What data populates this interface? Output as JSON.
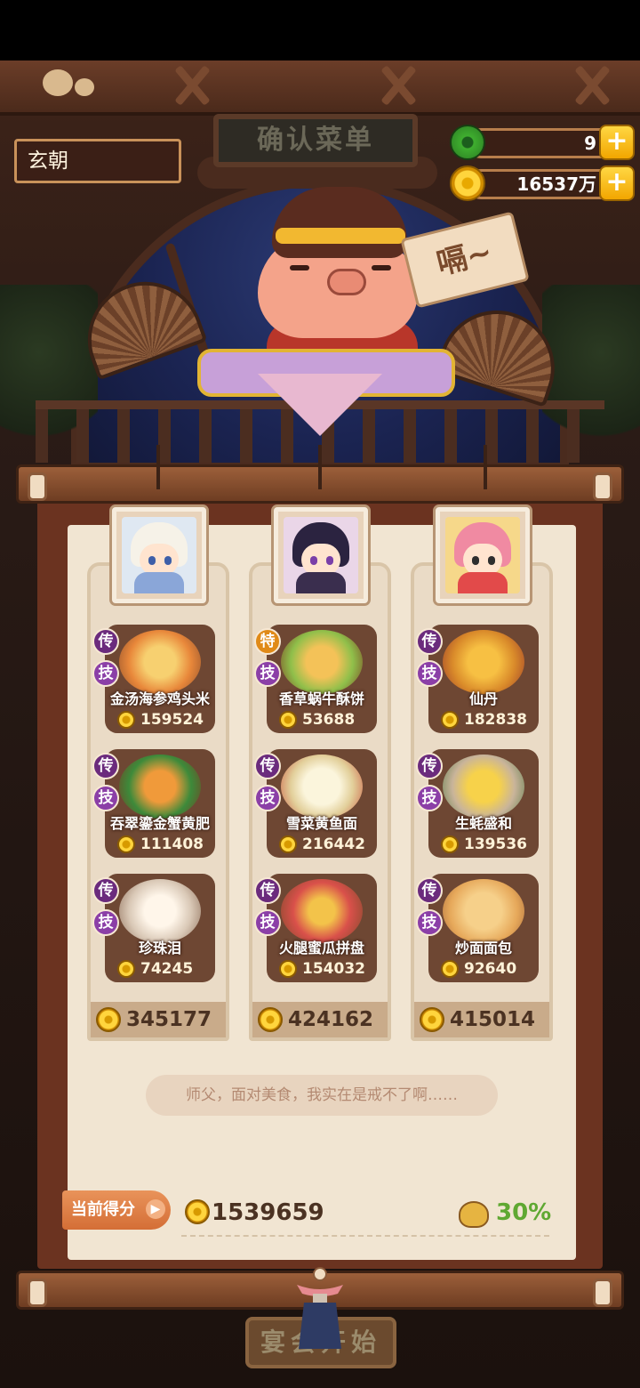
{
  "header": {
    "sign_title": "确认菜单",
    "player_name": "玄朝"
  },
  "currency": {
    "jade": "9",
    "coins": "16537万",
    "plus": "+"
  },
  "character": {
    "speech_tag": "嗝~"
  },
  "columns": [
    {
      "total": "345177",
      "dishes": [
        {
          "badge1": "传",
          "badge2": "技",
          "name": "金汤海参鸡头米",
          "score": "159524"
        },
        {
          "badge1": "传",
          "badge2": "技",
          "name": "吞翠鎏金蟹黄肥",
          "score": "111408"
        },
        {
          "badge1": "传",
          "badge2": "技",
          "name": "珍珠泪",
          "score": "74245"
        }
      ]
    },
    {
      "total": "424162",
      "dishes": [
        {
          "badge1": "特",
          "badge2": "技",
          "name": "香草蜗牛酥饼",
          "score": "53688"
        },
        {
          "badge1": "传",
          "badge2": "技",
          "name": "雪菜黄鱼面",
          "score": "216442"
        },
        {
          "badge1": "传",
          "badge2": "技",
          "name": "火腿蜜瓜拼盘",
          "score": "154032"
        }
      ]
    },
    {
      "total": "415014",
      "dishes": [
        {
          "badge1": "传",
          "badge2": "技",
          "name": "仙丹",
          "score": "182838"
        },
        {
          "badge1": "传",
          "badge2": "技",
          "name": "生蚝盛和",
          "score": "139536"
        },
        {
          "badge1": "传",
          "badge2": "技",
          "name": "炒面面包",
          "score": "92640"
        }
      ]
    }
  ],
  "quote": "师父，面对美食，我实在是戒不了啊……",
  "score": {
    "label": "当前得分",
    "arrow": "▶",
    "value": "1539659",
    "bonus": "30%"
  },
  "start_button": "宴会开始",
  "colors": {
    "paper": "#f1e5d2",
    "board": "#6b3320",
    "bonus": "#5fa832",
    "badge_chuan": "#6b2b7d",
    "badge_te": "#e08a18"
  }
}
